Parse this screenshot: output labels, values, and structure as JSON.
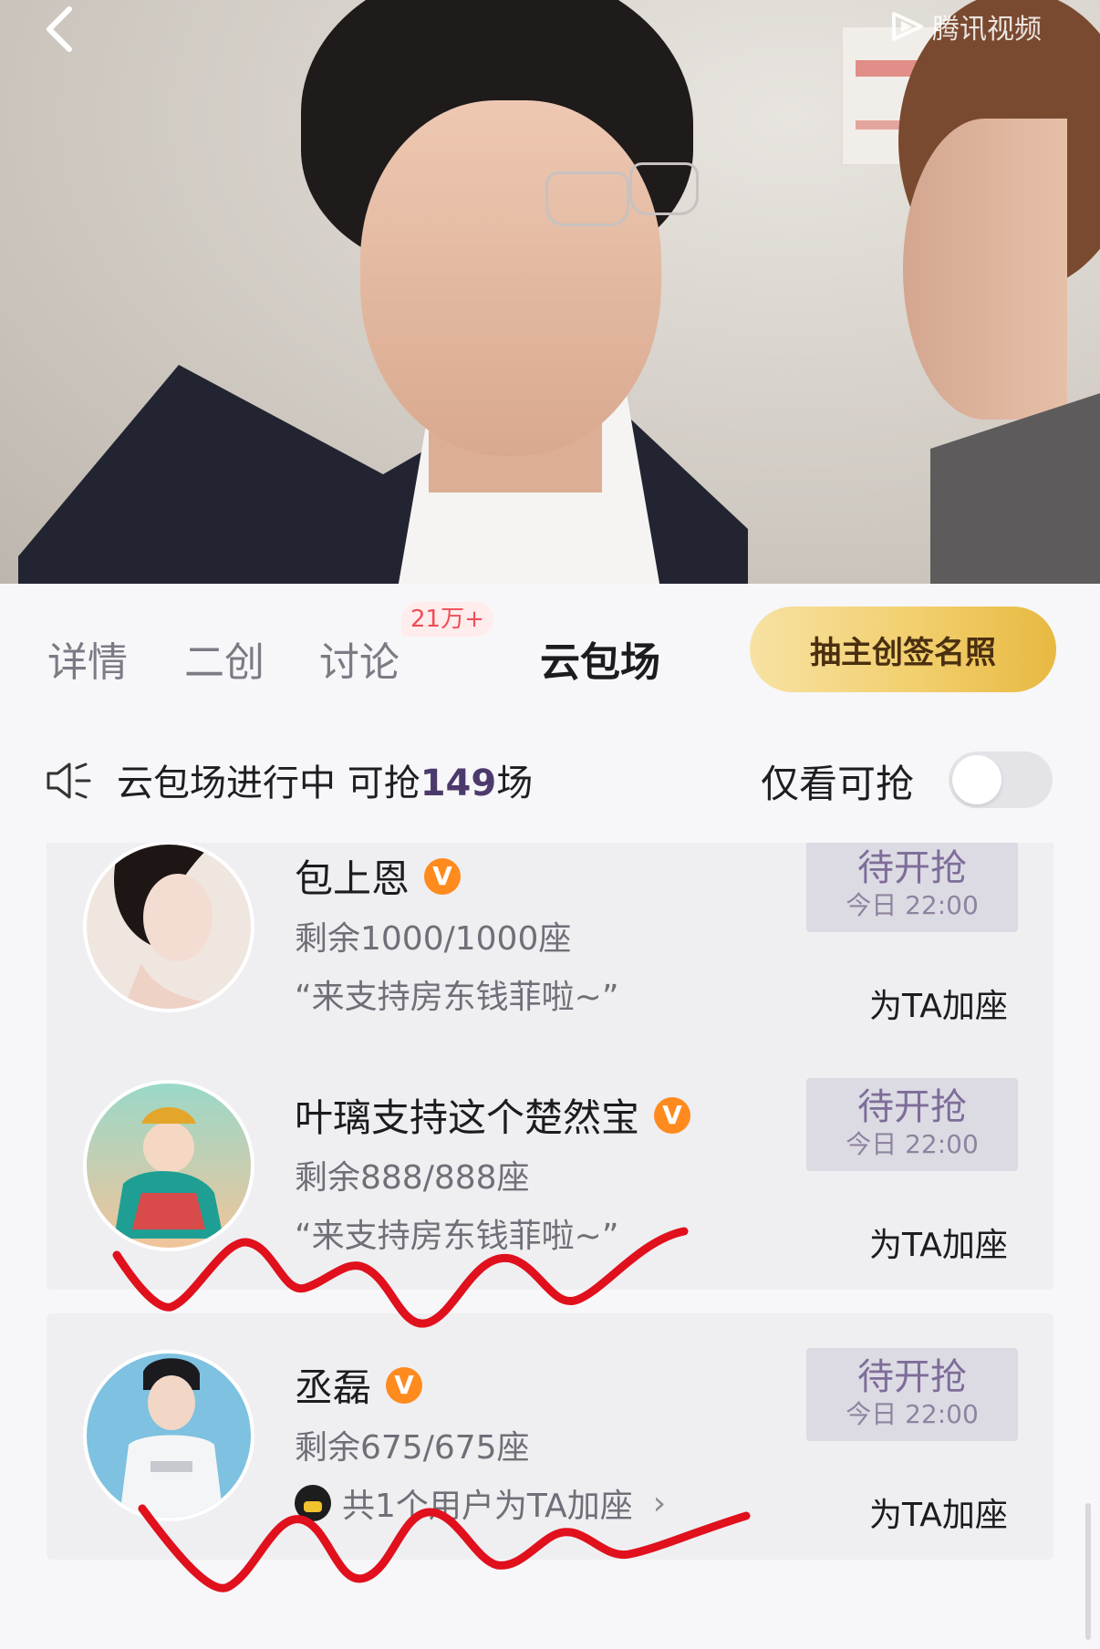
{
  "video": {
    "watermark_text": "腾讯视频",
    "back_icon": "chevron-left-icon"
  },
  "tabs": {
    "items": [
      "详情",
      "二创",
      "讨论",
      "云包场"
    ],
    "active_index": 3,
    "discuss_badge": "21万+",
    "cta_label": "抽主创签名照"
  },
  "filter": {
    "status_prefix": "云包场进行中 可抢",
    "count": "149",
    "status_suffix": "场",
    "only_available_label": "仅看可抢",
    "toggle_on": false
  },
  "cards": [
    {
      "name": "包上恩",
      "verified": true,
      "seats": "剩余1000/1000座",
      "slogan": "“来支持房东钱菲啦~”",
      "status": "待开抢",
      "time": "今日 22:00",
      "action": "为TA加座"
    },
    {
      "name": "叶璃支持这个楚然宝",
      "verified": true,
      "seats": "剩余888/888座",
      "slogan": "“来支持房东钱菲啦~”",
      "status": "待开抢",
      "time": "今日 22:00",
      "action": "为TA加座"
    },
    {
      "name": "丞磊",
      "verified": true,
      "seats": "剩余675/675座",
      "users_line": "共1个用户为TA加座",
      "status": "待开抢",
      "time": "今日 22:00",
      "action": "为TA加座"
    }
  ],
  "colors": {
    "accent_purple": "#4c3a6c",
    "gold": "#f2cf6d",
    "badge_red": "#ef4d57",
    "scribble_red": "#e0101c"
  }
}
